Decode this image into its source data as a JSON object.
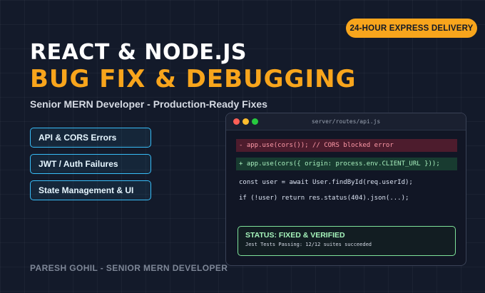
{
  "badge": "24-HOUR EXPRESS DELIVERY",
  "title_line1": "REACT & NODE.JS",
  "title_line2": "BUG FIX & DEBUGGING",
  "subtitle": "Senior MERN Developer - Production-Ready Fixes",
  "skills": [
    "API & CORS Errors",
    "JWT / Auth Failures",
    "State Management & UI"
  ],
  "editor": {
    "filename": "server/routes/api.js",
    "removed_line": "- app.use(cors()); // CORS blocked error",
    "added_line": "+ app.use(cors({ origin: process.env.CLIENT_URL }));",
    "code_line_1": "const user = await User.findById(req.userId);",
    "code_line_2": "if (!user) return res.status(404).json(...);"
  },
  "status": {
    "title": "STATUS: FIXED & VERIFIED",
    "detail": "Jest Tests Passing: 12/12 suites succeeded"
  },
  "author": "PARESH GOHIL - SENIOR MERN DEVELOPER",
  "colors": {
    "accent": "#f8a51c",
    "skill_border": "#38bdf8",
    "status_border": "#7ee29a",
    "background": "#131a2a"
  }
}
